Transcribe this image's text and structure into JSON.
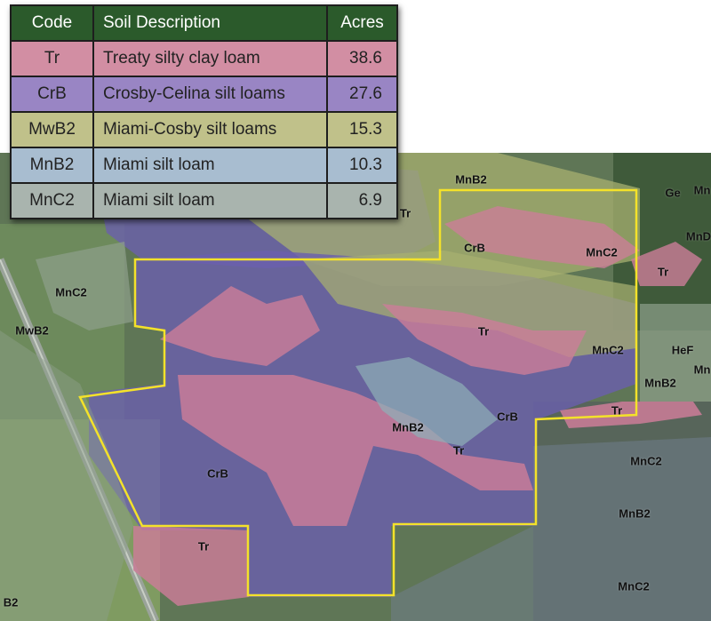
{
  "legend": {
    "headers": {
      "code": "Code",
      "description": "Soil Description",
      "acres": "Acres"
    },
    "header_color": "#2b5a2b",
    "rows": [
      {
        "code": "Tr",
        "description": "Treaty silty clay loam",
        "acres": "38.6",
        "color": "#d28ea3"
      },
      {
        "code": "CrB",
        "description": "Crosby-Celina silt loams",
        "acres": "27.6",
        "color": "#9985c4"
      },
      {
        "code": "MwB2",
        "description": "Miami-Cosby silt loams",
        "acres": "15.3",
        "color": "#c0c18a"
      },
      {
        "code": "MnB2",
        "description": "Miami silt loam",
        "acres": "10.3",
        "color": "#a8bdd0"
      },
      {
        "code": "MnC2",
        "description": "Miami silt loam",
        "acres": "6.9",
        "color": "#a9b4ae"
      }
    ]
  },
  "map": {
    "boundary_color": "#f4e22a",
    "labels": {
      "mnb2_top": "MnB2",
      "ge": "Ge",
      "mn_edge_1": "Mn",
      "mnd": "MnD",
      "tr_partial": "Tr",
      "crb_ne": "CrB",
      "mnc2_ne": "MnC2",
      "tr_east": "Tr",
      "mnc2_west": "MnC2",
      "mwb2_west": "MwB2",
      "tr_center": "Tr",
      "mnc2_east": "MnC2",
      "hef": "HeF",
      "mn_edge_2": "Mn",
      "mnb2_east": "MnB2",
      "tr_east_strip": "Tr",
      "crb_center": "CrB",
      "mnb2_center": "MnB2",
      "tr_south_center": "Tr",
      "mnc2_se": "MnC2",
      "crb_sw": "CrB",
      "mnb2_se": "MnB2",
      "tr_south": "Tr",
      "mnc2_far_se": "MnC2",
      "b2_edge": "B2"
    }
  }
}
